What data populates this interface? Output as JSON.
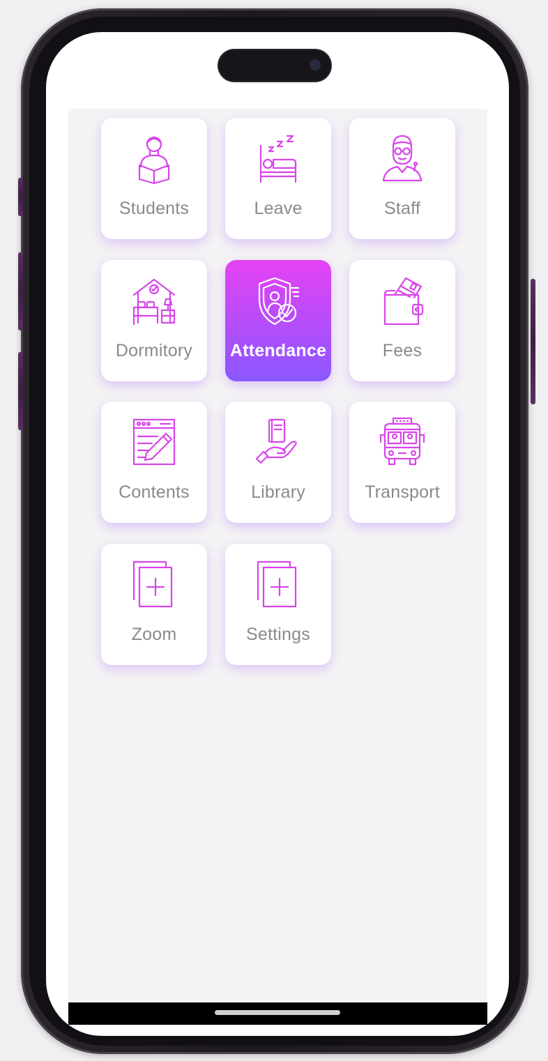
{
  "theme": {
    "accent_start": "#e542f3",
    "accent_end": "#8a57ff",
    "icon_color": "#d844ea",
    "label_color": "#8a8a8e"
  },
  "menu": {
    "tiles": [
      {
        "label": "Students",
        "icon": "student-reading-icon",
        "active": false
      },
      {
        "label": "Leave",
        "icon": "sleeping-bed-icon",
        "active": false
      },
      {
        "label": "Staff",
        "icon": "teacher-icon",
        "active": false
      },
      {
        "label": "Dormitory",
        "icon": "dormitory-icon",
        "active": false
      },
      {
        "label": "Attendance",
        "icon": "attendance-shield-icon",
        "active": true
      },
      {
        "label": "Fees",
        "icon": "wallet-icon",
        "active": false
      },
      {
        "label": "Contents",
        "icon": "content-edit-icon",
        "active": false
      },
      {
        "label": "Library",
        "icon": "library-book-icon",
        "active": false
      },
      {
        "label": "Transport",
        "icon": "bus-icon",
        "active": false
      },
      {
        "label": "Zoom",
        "icon": "add-copy-icon",
        "active": false
      },
      {
        "label": "Settings",
        "icon": "add-copy-icon",
        "active": false
      }
    ]
  }
}
